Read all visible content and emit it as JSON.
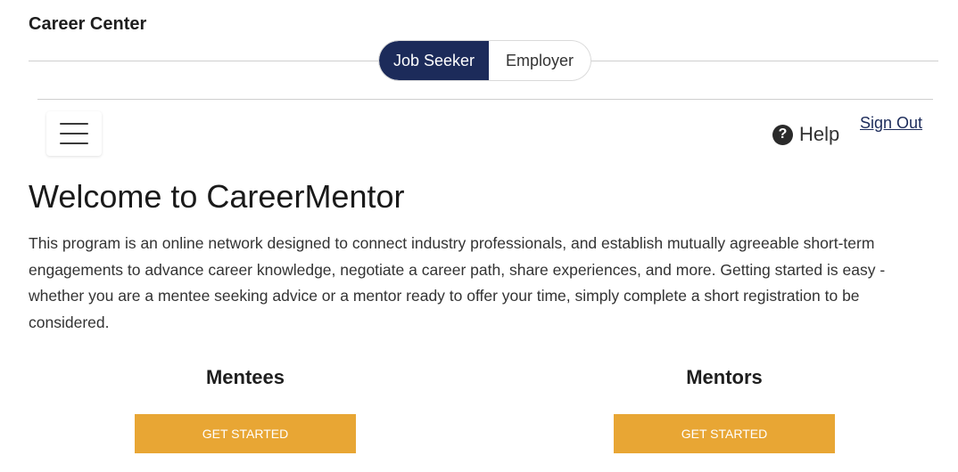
{
  "header": {
    "app_title": "Career Center"
  },
  "role_toggle": {
    "options": [
      {
        "label": "Job Seeker",
        "active": true
      },
      {
        "label": "Employer",
        "active": false
      }
    ]
  },
  "nav": {
    "menu_icon": "hamburger-menu-icon",
    "help_icon": "question-circle-icon",
    "help_label": "Help",
    "sign_out_label": "Sign Out"
  },
  "main": {
    "title": "Welcome to CareerMentor",
    "intro": "This program is an online network designed to connect industry professionals, and establish mutually agreeable short-term engagements to advance career knowledge, negotiate a career path, share experiences, and more. Getting started is easy - whether you are a mentee seeking advice or a mentor ready to offer your time, simply complete a short registration to be considered.",
    "columns": [
      {
        "heading": "Mentees",
        "button_label": "GET STARTED"
      },
      {
        "heading": "Mentors",
        "button_label": "GET STARTED"
      }
    ]
  },
  "colors": {
    "toggle_active_bg": "#1c2b5a",
    "cta_bg": "#e8a634"
  }
}
